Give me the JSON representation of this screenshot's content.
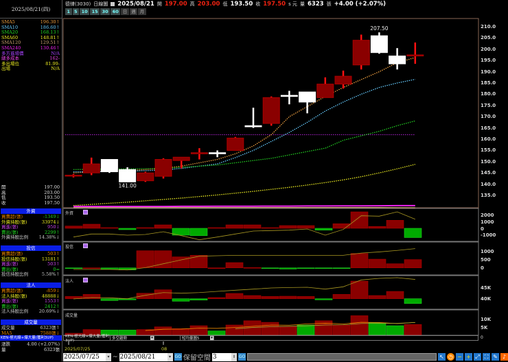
{
  "header": {
    "stock": "德律(3030)",
    "chart_type": "日線圖",
    "date": "2025/08/21",
    "open_label": "開",
    "open": "197.00",
    "high_label": "高",
    "high": "203.00",
    "low_label": "低",
    "low": "193.50",
    "close_label": "收",
    "close": "197.50",
    "unit": "s 元",
    "vol_label": "量",
    "volume": "6323",
    "vol_unit": "張",
    "change": "+4.00 (+2.07%)"
  },
  "periods": [
    "1",
    "5",
    "10",
    "15",
    "30",
    "60",
    "日",
    "週",
    "月"
  ],
  "left": {
    "date": "2025/08/21(四)",
    "ma": [
      {
        "label": "SMA5",
        "value": "196.30↑",
        "color": "#f0a040"
      },
      {
        "label": "SMA10",
        "value": "186.60↑",
        "color": "#6cf"
      },
      {
        "label": "SMA20",
        "value": "168.13↑",
        "color": "#2d2"
      },
      {
        "label": "SMA60",
        "value": "148.81↑",
        "color": "#ee2"
      },
      {
        "label": "SMA120",
        "value": "129.51↑",
        "color": "#c9a070"
      },
      {
        "label": "SMA240",
        "value": "130.46↑",
        "color": "#e2e"
      },
      {
        "label": "多方進場價",
        "value": "N/A",
        "color": "#a4f"
      },
      {
        "label": "總多成本",
        "value": "162-",
        "color": "#e4e"
      },
      {
        "label": "多出場位",
        "value": "81.99-",
        "color": "#ee2"
      },
      {
        "label": "出場",
        "value": "N/A",
        "color": "#ee2"
      }
    ],
    "ohlc": [
      {
        "label": "開",
        "value": "197.00"
      },
      {
        "label": "高",
        "value": "203.00"
      },
      {
        "label": "低",
        "value": "193.50"
      },
      {
        "label": "收",
        "value": "197.50"
      }
    ],
    "sections": [
      {
        "title": "外資",
        "rows": [
          {
            "label": "買賣超(張)",
            "value": "-1349↓",
            "lc": "#e80",
            "vc": "#2c2"
          },
          {
            "label": "外資持股(張)",
            "value": "33974↓",
            "lc": "#ee2",
            "vc": "#ee2"
          },
          {
            "label": "買進(張)",
            "value": "950↓",
            "lc": "#c4e",
            "vc": "#c4e"
          },
          {
            "label": "賣出(張)",
            "value": "2299↑",
            "lc": "#2d2",
            "vc": "#2d2"
          },
          {
            "label": "外資持股比例",
            "value": "14.38%↓",
            "lc": "#ccc",
            "vc": "#ccc"
          }
        ]
      },
      {
        "title": "投信",
        "rows": [
          {
            "label": "買賣超(張)",
            "value": "503↑",
            "lc": "#e80",
            "vc": "#e80"
          },
          {
            "label": "投信持股(張)",
            "value": "13181↑",
            "lc": "#ee2",
            "vc": "#ee2"
          },
          {
            "label": "買進(張)",
            "value": "503↑",
            "lc": "#c4e",
            "vc": "#c4e"
          },
          {
            "label": "賣出(張)",
            "value": "0=",
            "lc": "#2d2",
            "vc": "#2d2"
          },
          {
            "label": "投信持股比例",
            "value": "5.58%↑",
            "lc": "#ccc",
            "vc": "#ccc"
          }
        ]
      },
      {
        "title": "法人",
        "rows": [
          {
            "label": "買賣超(張)",
            "value": "-859↓",
            "lc": "#e80",
            "vc": "#e80"
          },
          {
            "label": "法人持股(張)",
            "value": "48888↓",
            "lc": "#ee2",
            "vc": "#ee2"
          },
          {
            "label": "買進(張)",
            "value": "1553↑",
            "lc": "#c4e",
            "vc": "#c4e"
          },
          {
            "label": "賣出(張)",
            "value": "2412↑",
            "lc": "#2d2",
            "vc": "#2d2"
          },
          {
            "label": "法人持股比例",
            "value": "20.69%↓",
            "lc": "#ccc",
            "vc": "#ccc"
          }
        ]
      },
      {
        "title": "成交量",
        "rows": [
          {
            "label": "成交量",
            "value": "6323張↑",
            "lc": "#ccc",
            "vc": "#ccc"
          },
          {
            "label": "MA5",
            "value": "7588張↓",
            "lc": "#e80",
            "vc": "#e80"
          },
          {
            "label": "MA10",
            "value": "7518張↑",
            "lc": "#ee2",
            "vc": "#ee2"
          }
        ]
      }
    ],
    "strategy": "KEN-極光線+爆大量(獲利3UP)",
    "change_label": "漲跌",
    "change_value": "4.00 (+2.07%)",
    "vol_label": "量",
    "vol_value": "6323張"
  },
  "panels": {
    "foreign": "外資",
    "trust": "投信",
    "inst": "法人",
    "volume": "成交量"
  },
  "dropdowns": [
    "KEN-極光線+爆大量(獲利3UP)",
    "多空趨勢",
    "短均量圖5"
  ],
  "dd_right": "0",
  "xaxis": {
    "first": "2025/07/25",
    "month": "08"
  },
  "toolbar": {
    "from": "2025/07/25",
    "tilde": "~",
    "to": "2025/08/21",
    "go": "GO",
    "keep_label": "保留空間",
    "keep_value": "3"
  },
  "chart_data": {
    "type": "candlestick",
    "dates": [
      "07/25",
      "07/28",
      "07/29",
      "07/30",
      "07/31",
      "08/01",
      "08/04",
      "08/05",
      "08/06",
      "08/07",
      "08/08",
      "08/11",
      "08/12",
      "08/13",
      "08/14",
      "08/15",
      "08/18",
      "08/19",
      "08/20",
      "08/21"
    ],
    "ohlc": [
      [
        144,
        144.5,
        143,
        144
      ],
      [
        145,
        151.8,
        144,
        149
      ],
      [
        151,
        151,
        145,
        145.5
      ],
      [
        146.5,
        147.5,
        141,
        141
      ],
      [
        141.5,
        145.5,
        141,
        145
      ],
      [
        143.5,
        151.5,
        142.5,
        151
      ],
      [
        150.5,
        152,
        147,
        152
      ],
      [
        153.5,
        156,
        151,
        154
      ],
      [
        154,
        155,
        152,
        153.5
      ],
      [
        155,
        161,
        155,
        160.5
      ],
      [
        166,
        174,
        165,
        165.5
      ],
      [
        167,
        179,
        166,
        178.5
      ],
      [
        179.5,
        181.5,
        175.5,
        179
      ],
      [
        181,
        181,
        171.5,
        176.5
      ],
      [
        178.5,
        187.5,
        178.5,
        184.5
      ],
      [
        184.5,
        190.5,
        182.5,
        188
      ],
      [
        193,
        206.5,
        191,
        204
      ],
      [
        206,
        207.5,
        198,
        198.5
      ],
      [
        197,
        200.5,
        191,
        193.5
      ],
      [
        197,
        203,
        193.5,
        197.5
      ]
    ],
    "annotations": [
      {
        "text": "141.00",
        "index": 3,
        "price": 141
      },
      {
        "text": "207.50",
        "index": 17,
        "price": 207.5
      }
    ],
    "yaxis": {
      "ticks": [
        "210.0",
        "205.0",
        "200.0",
        "195.0",
        "190.0",
        "185.0",
        "180.0",
        "175.0",
        "170.0",
        "165.0",
        "160.0",
        "155.0",
        "150.0",
        "145.0",
        "140.0",
        "135.0"
      ],
      "range": [
        129.5,
        213
      ]
    },
    "hline": {
      "value": 162,
      "color": "#a2c"
    },
    "ma": [
      {
        "name": "SMA5",
        "color": "#f0a040",
        "values": [
          145,
          145.5,
          146,
          146,
          146.5,
          147,
          148,
          149.5,
          151,
          153.5,
          157,
          162,
          170,
          174.5,
          179,
          183,
          186.5,
          190,
          194,
          196.3
        ]
      },
      {
        "name": "SMA10",
        "color": "#6cf",
        "values": [
          145.5,
          145.5,
          145.7,
          145.8,
          146,
          146.3,
          147,
          148,
          149,
          151.8,
          155,
          159,
          163,
          167.5,
          172.5,
          176.5,
          180,
          183,
          185,
          186.6
        ]
      },
      {
        "name": "SMA20",
        "color": "#2c2",
        "values": [
          146.5,
          146.6,
          146.7,
          146.8,
          146.9,
          147,
          147.5,
          148,
          148.5,
          149.5,
          150.5,
          151.5,
          153,
          154.5,
          156,
          159.5,
          161.5,
          163.5,
          166,
          168.13
        ]
      },
      {
        "name": "SMA60",
        "color": "#ee2",
        "values": [
          130.5,
          131,
          131.5,
          132,
          132.6,
          133.2,
          133.8,
          134.5,
          135.2,
          136,
          136.8,
          137.7,
          138.6,
          139.6,
          140.7,
          141.9,
          143.3,
          145,
          146.8,
          148.81
        ]
      },
      {
        "name": "SMA120",
        "color": "#c9a070",
        "values": [
          129.6,
          129.6,
          129.6,
          129.6,
          129.6,
          129.6,
          129.6,
          129.6,
          129.6,
          129.6,
          129.6,
          129.6,
          129.6,
          129.6,
          129.6,
          129.6,
          129.6,
          129.6,
          129.55,
          129.51
        ]
      },
      {
        "name": "SMA240",
        "color": "#e2e",
        "values": [
          130.1,
          130.1,
          130.1,
          130.1,
          130.1,
          130.1,
          130.15,
          130.15,
          130.2,
          130.2,
          130.2,
          130.25,
          130.25,
          130.3,
          130.3,
          130.35,
          130.35,
          130.4,
          130.45,
          130.46
        ]
      }
    ],
    "foreign": {
      "yticks": [
        "2000",
        "1000",
        "0",
        "-1000"
      ],
      "bars": [
        330,
        600,
        100,
        -200,
        100,
        500,
        -1000,
        -1070,
        100,
        500,
        500,
        100,
        400,
        400,
        -270,
        670,
        2400,
        270,
        1170,
        -1349
      ],
      "line": [
        -1270,
        -830,
        -830,
        -1000,
        -900,
        -500,
        -1070,
        -1670,
        -1270,
        -830,
        -400,
        -330,
        -270,
        -100,
        -1000,
        -170,
        1830,
        1770,
        2400,
        1330
      ]
    },
    "trust": {
      "yticks": [
        "1000",
        "500",
        "0"
      ],
      "bars": [
        -20,
        0,
        -70,
        -125,
        1040,
        1040,
        667,
        764,
        0,
        320,
        20,
        -20,
        -70,
        -10,
        -20,
        -20,
        875,
        528,
        250,
        503
      ],
      "line": [
        -97,
        -97,
        -97,
        -125,
        14,
        250,
        486,
        708,
        736,
        764,
        764,
        764,
        764,
        764,
        764,
        764,
        900,
        970,
        1060,
        1170
      ]
    },
    "inst": {
      "yticks": [
        "45K",
        "40K"
      ],
      "bars": [
        410,
        780,
        -330,
        -205,
        984,
        1600,
        -450,
        -245,
        205,
        945,
        575,
        410,
        450,
        410,
        -205,
        780,
        3160,
        575,
        1310,
        -859
      ],
      "holdings": [
        40000,
        40625,
        40530,
        40100,
        41660,
        42900,
        42600,
        42900,
        43440,
        43970,
        44470,
        45000,
        45200,
        45310,
        44470,
        45530,
        48650,
        49375,
        49690,
        48888
      ]
    },
    "volume": {
      "yticks": [
        "10K",
        "5K"
      ],
      "bars": [
        960,
        3200,
        2900,
        2900,
        3200,
        4860,
        3750,
        5560,
        2360,
        6000,
        8600,
        7640,
        5140,
        6000,
        8600,
        6000,
        11700,
        7360,
        5560,
        6323
      ],
      "up": [
        true,
        true,
        false,
        false,
        true,
        true,
        true,
        true,
        false,
        true,
        true,
        true,
        true,
        false,
        true,
        true,
        true,
        false,
        false,
        true
      ],
      "ma5": [
        null,
        null,
        null,
        null,
        2630,
        3410,
        3520,
        4050,
        3940,
        4500,
        5230,
        5960,
        5890,
        6680,
        7080,
        6680,
        7670,
        7540,
        6850,
        7588
      ],
      "ma10": [
        null,
        null,
        null,
        null,
        null,
        null,
        null,
        null,
        null,
        3730,
        4510,
        4950,
        5190,
        5500,
        6040,
        6120,
        6890,
        7070,
        6970,
        7518
      ]
    }
  }
}
